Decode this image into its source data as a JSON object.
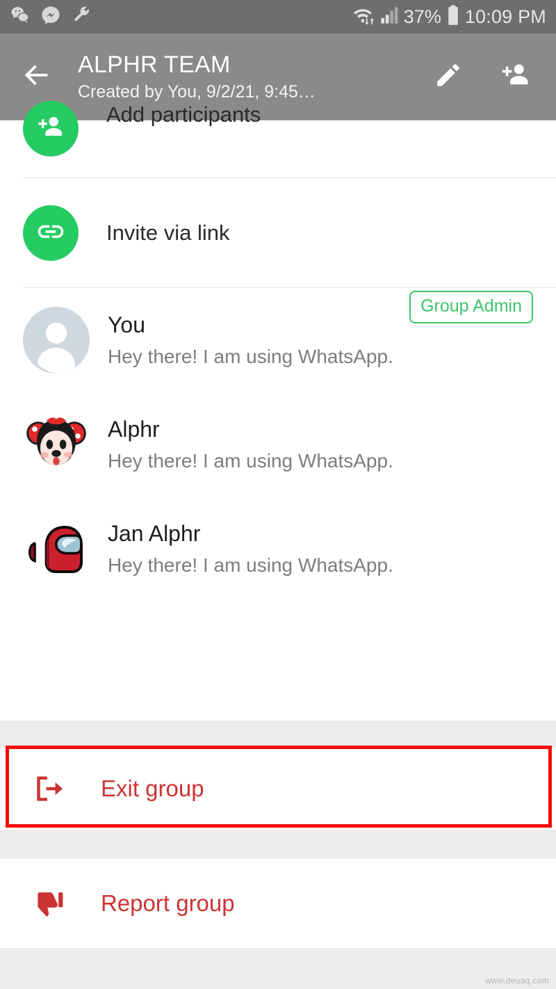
{
  "status_bar": {
    "left_icons": [
      "wechat-icon",
      "messenger-icon",
      "wrench-icon"
    ],
    "wifi_icon": "wifi-icon",
    "signal_icon": "signal-bars-icon",
    "battery_percent": "37%",
    "battery_icon": "battery-icon",
    "time": "10:09 PM"
  },
  "app_bar": {
    "back_icon": "back-arrow-icon",
    "title": "ALPHR TEAM",
    "subtitle": "Created by You, 9/2/21, 9:45…",
    "edit_icon": "pencil-icon",
    "add_participant_icon": "add-person-icon"
  },
  "actions": [
    {
      "id": "add-participants",
      "label": "Add participants",
      "icon": "add-person-icon",
      "icon_bg": "#26cc63"
    },
    {
      "id": "invite-via-link",
      "label": "Invite via link",
      "icon": "link-icon",
      "icon_bg": "#26cc63"
    }
  ],
  "participants": [
    {
      "name": "You",
      "status": "Hey there! I am using WhatsApp.",
      "avatar": "default-person-avatar",
      "badge": "Group Admin"
    },
    {
      "name": "Alphr",
      "status": "Hey there! I am using WhatsApp.",
      "avatar": "minnie-mouse-avatar",
      "badge": ""
    },
    {
      "name": "Jan Alphr",
      "status": "Hey there! I am using WhatsApp.",
      "avatar": "among-us-red-avatar",
      "badge": ""
    }
  ],
  "danger_actions": [
    {
      "id": "exit-group",
      "label": "Exit group",
      "icon": "exit-icon",
      "highlighted": true
    },
    {
      "id": "report-group",
      "label": "Report group",
      "icon": "thumbs-down-icon",
      "highlighted": false
    }
  ],
  "colors": {
    "status_bar_bg": "#6e6e6e",
    "app_bar_bg": "#8a8a8a",
    "whatsapp_green": "#26cc63",
    "admin_badge_green": "#3ec46d",
    "danger_red": "#cc3333",
    "annotation_red": "#f40d0d",
    "page_bg": "#ececec"
  },
  "watermark": "www.deuaq.com"
}
